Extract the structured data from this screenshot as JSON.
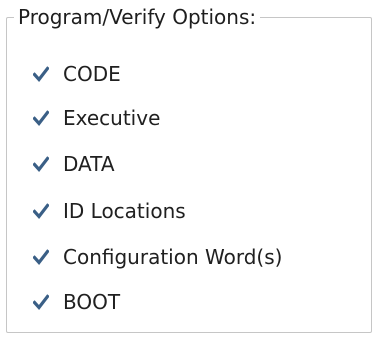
{
  "group": {
    "title": "Program/Verify Options:"
  },
  "options": [
    {
      "label": "CODE",
      "checked": true
    },
    {
      "label": "Executive",
      "checked": true
    },
    {
      "label": "DATA",
      "checked": true
    },
    {
      "label": "ID Locations",
      "checked": true
    },
    {
      "label": "Configuration Word(s)",
      "checked": true
    },
    {
      "label": "BOOT",
      "checked": true
    }
  ],
  "colors": {
    "checkmark": "#3a5f86",
    "border": "#c6c6c6",
    "text": "#1e1e1e"
  }
}
